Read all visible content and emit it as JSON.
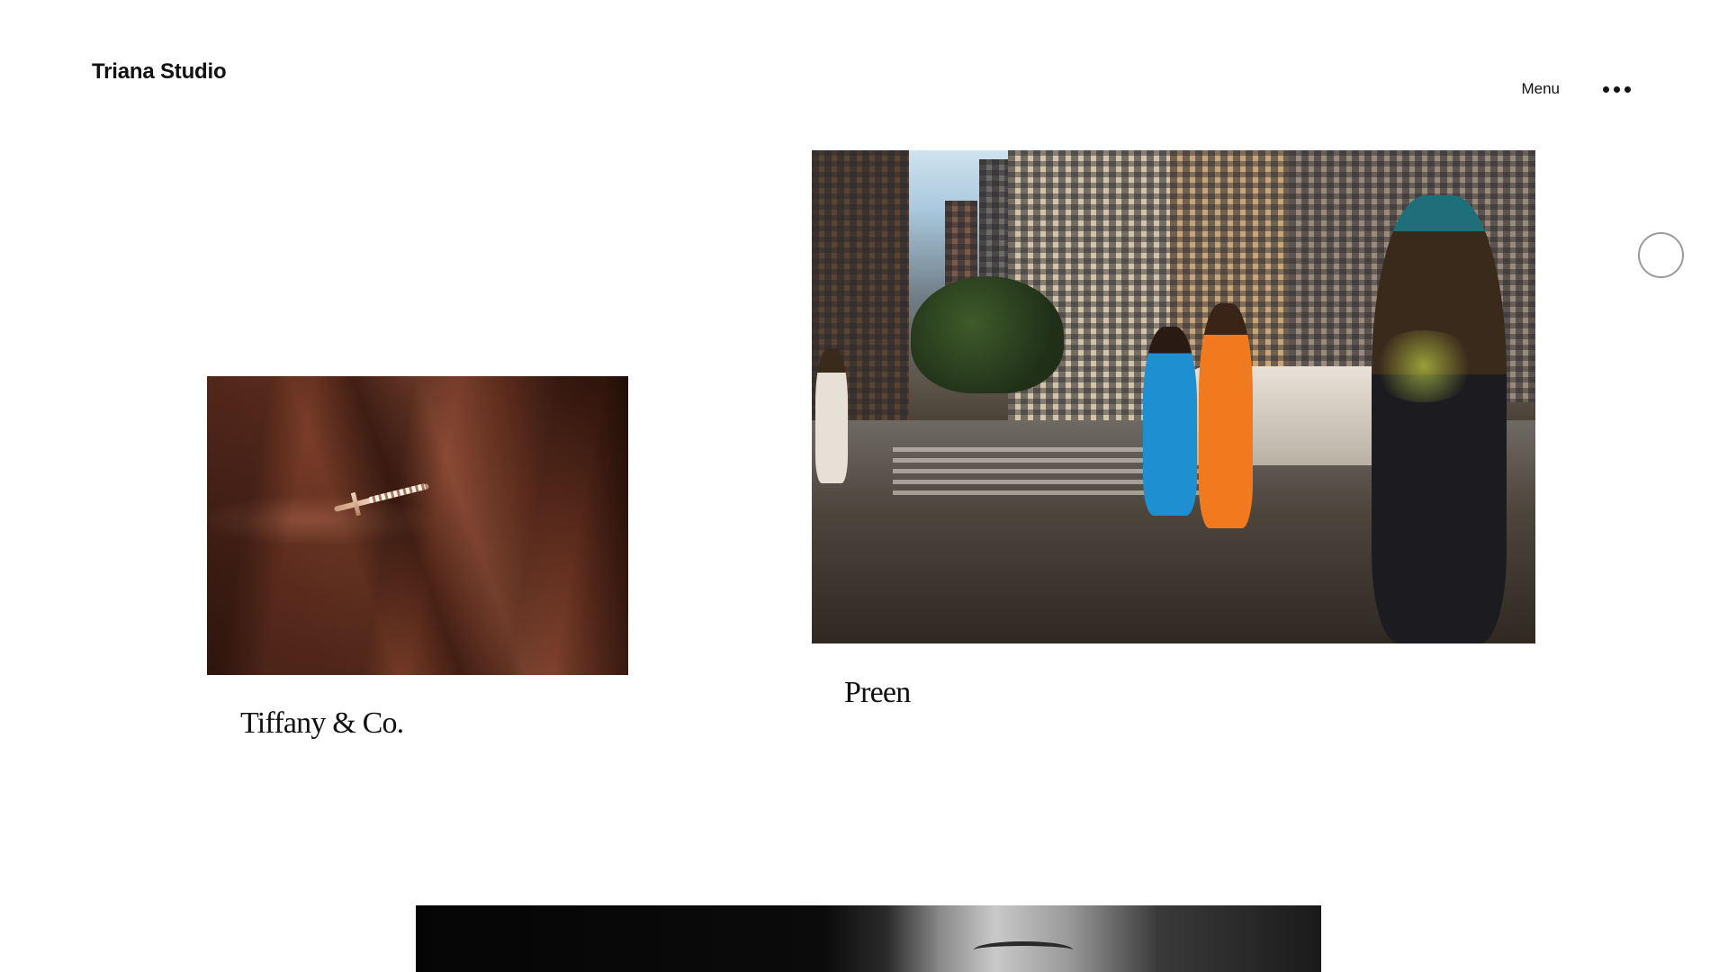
{
  "header": {
    "brand": "Triana Studio",
    "menu_label": "Menu",
    "menu_icon": "more-dots-icon"
  },
  "projects": [
    {
      "title": "Tiffany & Co.",
      "image": "hand-with-ring-photo"
    },
    {
      "title": "Preen",
      "image": "city-street-fashion-photo"
    },
    {
      "title": "",
      "image": "black-and-white-portrait-photo"
    }
  ],
  "cursor": {
    "icon": "cursor-circle-icon"
  },
  "colors": {
    "background": "#ffffff",
    "text": "#111111",
    "cursor_ring": "#9a9a9a"
  }
}
